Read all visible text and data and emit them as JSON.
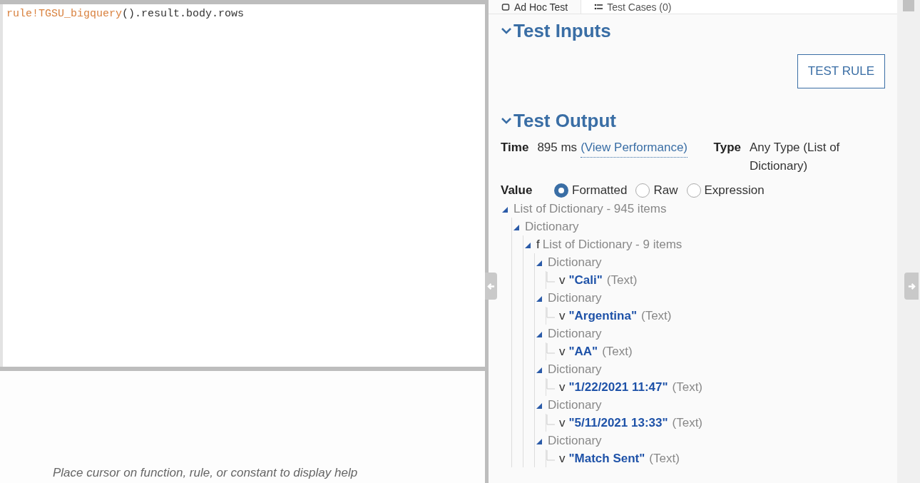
{
  "editor": {
    "code": [
      {
        "kind": "rule",
        "text": "rule!TGSU_bigquery"
      },
      {
        "kind": "plain",
        "text": "().result.body.rows"
      }
    ]
  },
  "help_text": "Place cursor on function, rule, or constant to display help",
  "tabs": [
    {
      "label": "Ad Hoc Test",
      "selected": true
    },
    {
      "label": "Test Cases (0)",
      "selected": false
    }
  ],
  "test_inputs": {
    "title": "Test Inputs",
    "expanded": true,
    "button": "TEST RULE"
  },
  "test_output": {
    "title": "Test Output",
    "expanded": true,
    "time_label": "Time",
    "time_value": "895 ms",
    "performance_link": "(View Performance)",
    "type_label": "Type",
    "type_value": "Any Type (List of Dictionary)",
    "value_label": "Value",
    "formats": [
      {
        "label": "Formatted",
        "selected": true
      },
      {
        "label": "Raw",
        "selected": false
      },
      {
        "label": "Expression",
        "selected": false
      }
    ],
    "tree": [
      {
        "label": "List of Dictionary - 945 items",
        "expanded": true,
        "children": [
          {
            "label": "Dictionary",
            "expanded": true,
            "children": [
              {
                "key": "f",
                "label": "List of Dictionary - 9 items",
                "expanded": true,
                "children": [
                  {
                    "label": "Dictionary",
                    "expanded": true,
                    "children": [
                      {
                        "key": "v",
                        "value": "\"Cali\"",
                        "type": "(Text)"
                      }
                    ]
                  },
                  {
                    "label": "Dictionary",
                    "expanded": true,
                    "children": [
                      {
                        "key": "v",
                        "value": "\"Argentina\"",
                        "type": "(Text)"
                      }
                    ]
                  },
                  {
                    "label": "Dictionary",
                    "expanded": true,
                    "children": [
                      {
                        "key": "v",
                        "value": "\"AA\"",
                        "type": "(Text)"
                      }
                    ]
                  },
                  {
                    "label": "Dictionary",
                    "expanded": true,
                    "children": [
                      {
                        "key": "v",
                        "value": "\"1/22/2021 11:47\"",
                        "type": "(Text)"
                      }
                    ]
                  },
                  {
                    "label": "Dictionary",
                    "expanded": true,
                    "children": [
                      {
                        "key": "v",
                        "value": "\"5/11/2021 13:33\"",
                        "type": "(Text)"
                      }
                    ]
                  },
                  {
                    "label": "Dictionary",
                    "expanded": true,
                    "children": [
                      {
                        "key": "v",
                        "value": "\"Match Sent\"",
                        "type": "(Text)"
                      }
                    ]
                  }
                ]
              }
            ]
          }
        ]
      }
    ]
  }
}
